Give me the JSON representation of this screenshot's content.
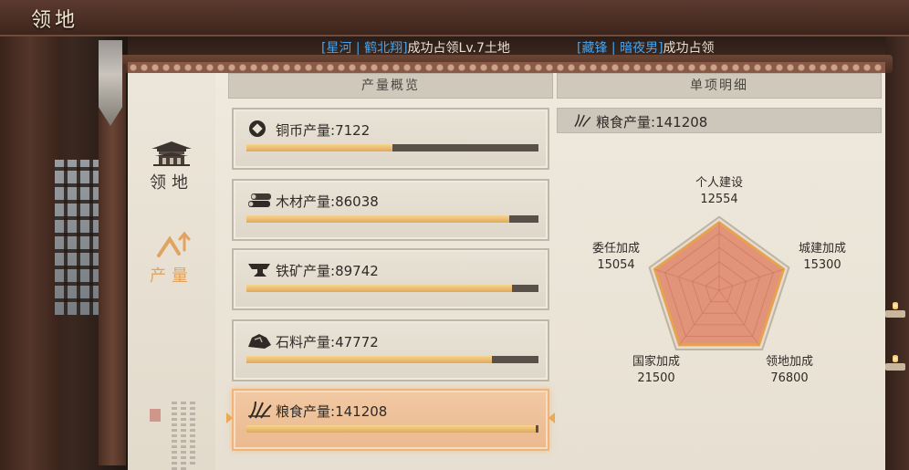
{
  "header": {
    "title": "领地"
  },
  "ticker": {
    "msg1_player": "[星河 | 鹤北翔]",
    "msg1_text": "成功占领Lv.7土地",
    "msg2_player": "[藏锋 | 暗夜男]",
    "msg2_text": "成功占领"
  },
  "nav": {
    "territory_label": "领地",
    "production_label": "产量"
  },
  "sections": {
    "overview_label": "产量概览",
    "detail_label": "单项明细"
  },
  "resources": [
    {
      "label": "铜币产量:",
      "value": "7122",
      "fill": 0.5,
      "icon": "coin-icon"
    },
    {
      "label": "木材产量:",
      "value": "86038",
      "fill": 0.9,
      "icon": "wood-icon"
    },
    {
      "label": "铁矿产量:",
      "value": "89742",
      "fill": 0.91,
      "icon": "anvil-icon"
    },
    {
      "label": "石料产量:",
      "value": "47772",
      "fill": 0.84,
      "icon": "stone-icon"
    },
    {
      "label": "粮食产量:",
      "value": "141208",
      "fill": 0.99,
      "icon": "grain-icon"
    }
  ],
  "selected_resource_index": 4,
  "detail": {
    "label": "粮食产量:",
    "value": "141208",
    "icon": "grain-icon"
  },
  "radar": {
    "personal": {
      "label": "个人建设",
      "value": "12554"
    },
    "city": {
      "label": "城建加成",
      "value": "15300"
    },
    "territory": {
      "label": "领地加成",
      "value": "76800"
    },
    "nation": {
      "label": "国家加成",
      "value": "21500"
    },
    "appointed": {
      "label": "委任加成",
      "value": "15054"
    }
  },
  "colors": {
    "progress_fill": "#e2a857",
    "progress_track": "#5a504a",
    "active_card": "#ebb98e",
    "radar_fill": "#e0876a",
    "ticker_player": "#4aa2e8"
  }
}
